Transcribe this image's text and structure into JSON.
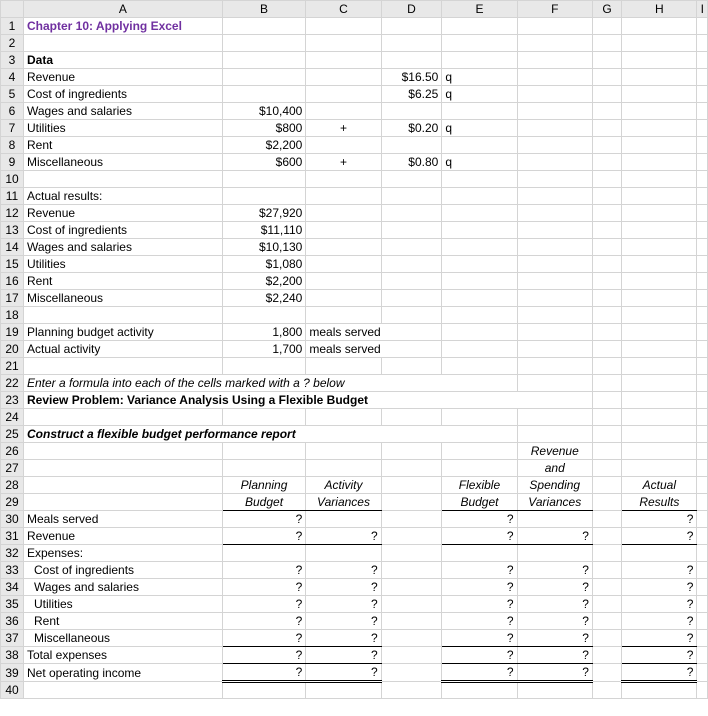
{
  "columns": [
    "A",
    "B",
    "C",
    "D",
    "E",
    "F",
    "G",
    "H",
    "I"
  ],
  "title": "Chapter 10: Applying Excel",
  "data_header": "Data",
  "data_rows": {
    "revenue": {
      "label": "Revenue",
      "B": "",
      "D": "$16.50",
      "E": "q"
    },
    "cost_ingredients": {
      "label": "Cost of ingredients",
      "B": "",
      "D": "$6.25",
      "E": "q"
    },
    "wages": {
      "label": "Wages and salaries",
      "B": "$10,400"
    },
    "utilities": {
      "label": "Utilities",
      "B": "$800",
      "C": "+",
      "D": "$0.20",
      "E": "q"
    },
    "rent": {
      "label": "Rent",
      "B": "$2,200"
    },
    "misc": {
      "label": "Miscellaneous",
      "B": "$600",
      "C": "+",
      "D": "$0.80",
      "E": "q"
    }
  },
  "actual_header": "Actual results:",
  "actual_rows": {
    "revenue": {
      "label": "Revenue",
      "B": "$27,920"
    },
    "cost_ingredients": {
      "label": "Cost of ingredients",
      "B": "$11,110"
    },
    "wages": {
      "label": "Wages and salaries",
      "B": "$10,130"
    },
    "utilities": {
      "label": "Utilities",
      "B": "$1,080"
    },
    "rent": {
      "label": "Rent",
      "B": "$2,200"
    },
    "misc": {
      "label": "Miscellaneous",
      "B": "$2,240"
    }
  },
  "activity": {
    "planning": {
      "label": "Planning budget activity",
      "B": "1,800",
      "C": "meals served"
    },
    "actual": {
      "label": "Actual activity",
      "B": "1,700",
      "C": "meals served"
    }
  },
  "instruction": "Enter a formula into each of the cells marked with a ? below",
  "review_title": "Review Problem: Variance Analysis Using a Flexible Budget",
  "construct_title": "Construct a flexible budget performance report",
  "colhead": {
    "planning1": "Planning",
    "planning2": "Budget",
    "activity1": "Activity",
    "activity2": "Variances",
    "flexible1": "Flexible",
    "flexible2": "Budget",
    "rev1": "Revenue",
    "rev2": "and",
    "spend1": "Spending",
    "spend2": "Variances",
    "actual1": "Actual",
    "actual2": "Results"
  },
  "report_rows": {
    "meals": {
      "label": "Meals served",
      "B": "?",
      "C": "",
      "E": "?",
      "F": "",
      "H": "?"
    },
    "revenue": {
      "label": "Revenue",
      "B": "?",
      "C": "?",
      "E": "?",
      "F": "?",
      "H": "?"
    },
    "exp_hdr": {
      "label": "Expenses:"
    },
    "cost": {
      "label": "Cost of ingredients",
      "B": "?",
      "C": "?",
      "E": "?",
      "F": "?",
      "H": "?"
    },
    "wages": {
      "label": "Wages and salaries",
      "B": "?",
      "C": "?",
      "E": "?",
      "F": "?",
      "H": "?"
    },
    "util": {
      "label": "Utilities",
      "B": "?",
      "C": "?",
      "E": "?",
      "F": "?",
      "H": "?"
    },
    "rent": {
      "label": "Rent",
      "B": "?",
      "C": "?",
      "E": "?",
      "F": "?",
      "H": "?"
    },
    "misc": {
      "label": "Miscellaneous",
      "B": "?",
      "C": "?",
      "E": "?",
      "F": "?",
      "H": "?"
    },
    "total": {
      "label": "Total expenses",
      "B": "?",
      "C": "?",
      "E": "?",
      "F": "?",
      "H": "?"
    },
    "netop": {
      "label": "Net operating income",
      "B": "?",
      "C": "?",
      "E": "?",
      "F": "?",
      "H": "?"
    }
  },
  "chart_data": {
    "type": "table",
    "title": "Flexible Budget Performance Report",
    "inputs": {
      "price_per_meal": 16.5,
      "variable_cost_ingredients_per_meal": 6.25,
      "fixed_wages": 10400,
      "fixed_utilities": 800,
      "variable_utilities_per_meal": 0.2,
      "fixed_rent": 2200,
      "fixed_misc": 600,
      "variable_misc_per_meal": 0.8,
      "planning_meals": 1800,
      "actual_meals": 1700
    },
    "actual_results": {
      "revenue": 27920,
      "cost_of_ingredients": 11110,
      "wages_and_salaries": 10130,
      "utilities": 1080,
      "rent": 2200,
      "miscellaneous": 2240
    },
    "report_columns": [
      "Planning Budget",
      "Activity Variances",
      "Flexible Budget",
      "Revenue and Spending Variances",
      "Actual Results"
    ],
    "report_row_labels": [
      "Meals served",
      "Revenue",
      "Cost of ingredients",
      "Wages and salaries",
      "Utilities",
      "Rent",
      "Miscellaneous",
      "Total expenses",
      "Net operating income"
    ]
  }
}
